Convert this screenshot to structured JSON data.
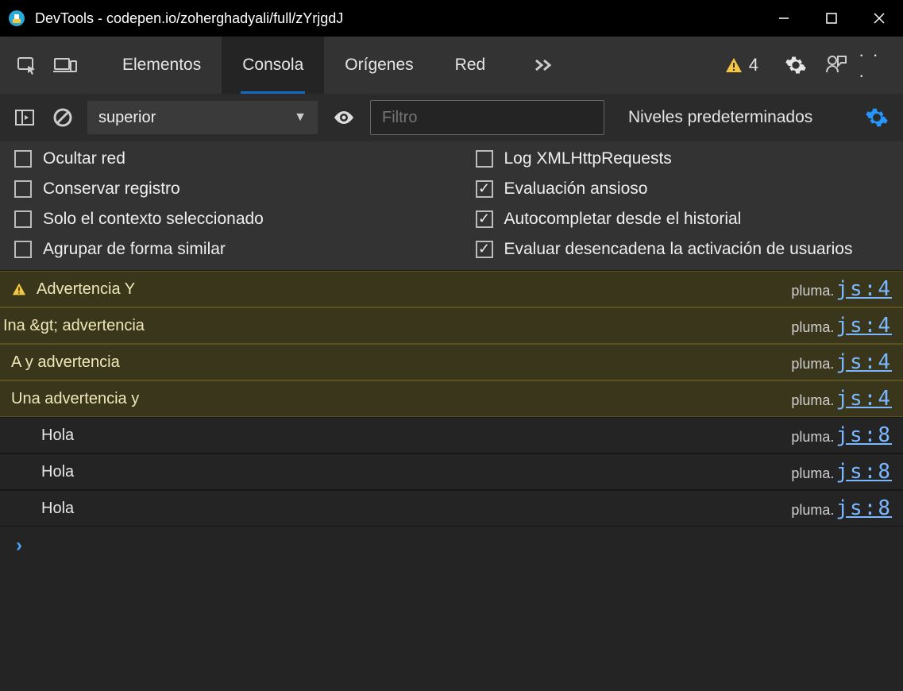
{
  "titlebar": {
    "title": "DevTools - codepen.io/zoherghadyali/full/zYrjgdJ"
  },
  "tabs": {
    "items": [
      "Elementos",
      "Consola",
      "Orígenes",
      "Red"
    ],
    "active_index": 1
  },
  "toolbar": {
    "warning_count": "4"
  },
  "filterbar": {
    "context": "superior",
    "filter_placeholder": "Filtro",
    "levels_label": "Niveles predeterminados"
  },
  "settings": {
    "left": [
      {
        "label": "Ocultar red",
        "checked": false
      },
      {
        "label": "Conservar registro",
        "checked": false
      },
      {
        "label": "Solo el contexto seleccionado",
        "checked": false
      },
      {
        "label": "Agrupar de forma similar",
        "checked": false
      }
    ],
    "right": [
      {
        "label": "Log XMLHttpRequests",
        "checked": false
      },
      {
        "label": "Evaluación ansioso",
        "checked": true
      },
      {
        "label": "Autocompletar desde el historial",
        "checked": true
      },
      {
        "label": "Evaluar desencadena la activación de usuarios",
        "checked": true
      }
    ]
  },
  "logs": [
    {
      "type": "warn",
      "icon": true,
      "msg": "Advertencia Y",
      "src_prefix": "pluma.",
      "src_loc": "js:4"
    },
    {
      "type": "warn",
      "icon": false,
      "msg": "Ina &gt; advertencia",
      "src_prefix": "pluma.",
      "src_loc": "js:4"
    },
    {
      "type": "warn",
      "icon": false,
      "msg": "A y advertencia",
      "src_prefix": "pluma.",
      "src_loc": "js:4"
    },
    {
      "type": "warn",
      "icon": false,
      "msg": "Una advertencia y",
      "src_prefix": "pluma.",
      "src_loc": "js:4"
    },
    {
      "type": "info",
      "icon": false,
      "msg": "Hola",
      "src_prefix": "pluma.",
      "src_loc": "js:8"
    },
    {
      "type": "info",
      "icon": false,
      "msg": "Hola",
      "src_prefix": "pluma.",
      "src_loc": "js:8"
    },
    {
      "type": "info",
      "icon": false,
      "msg": "Hola",
      "src_prefix": "pluma.",
      "src_loc": "js:8"
    }
  ],
  "prompt": "›"
}
